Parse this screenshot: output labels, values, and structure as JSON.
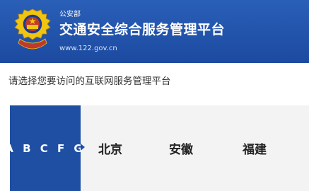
{
  "header": {
    "org": "公安部",
    "title": "交通安全综合服务管理平台",
    "url": "www.122.gov.cn"
  },
  "prompt": "请选择您要访问的互联网服务管理平台",
  "region_selector": {
    "letters_label": "A B C F G",
    "provinces": [
      "北京",
      "安徽",
      "福建"
    ]
  },
  "colors": {
    "header_blue": "#1c4aa0",
    "active_blue": "#1f4fa3",
    "bar_gray": "#f3f3f3"
  }
}
